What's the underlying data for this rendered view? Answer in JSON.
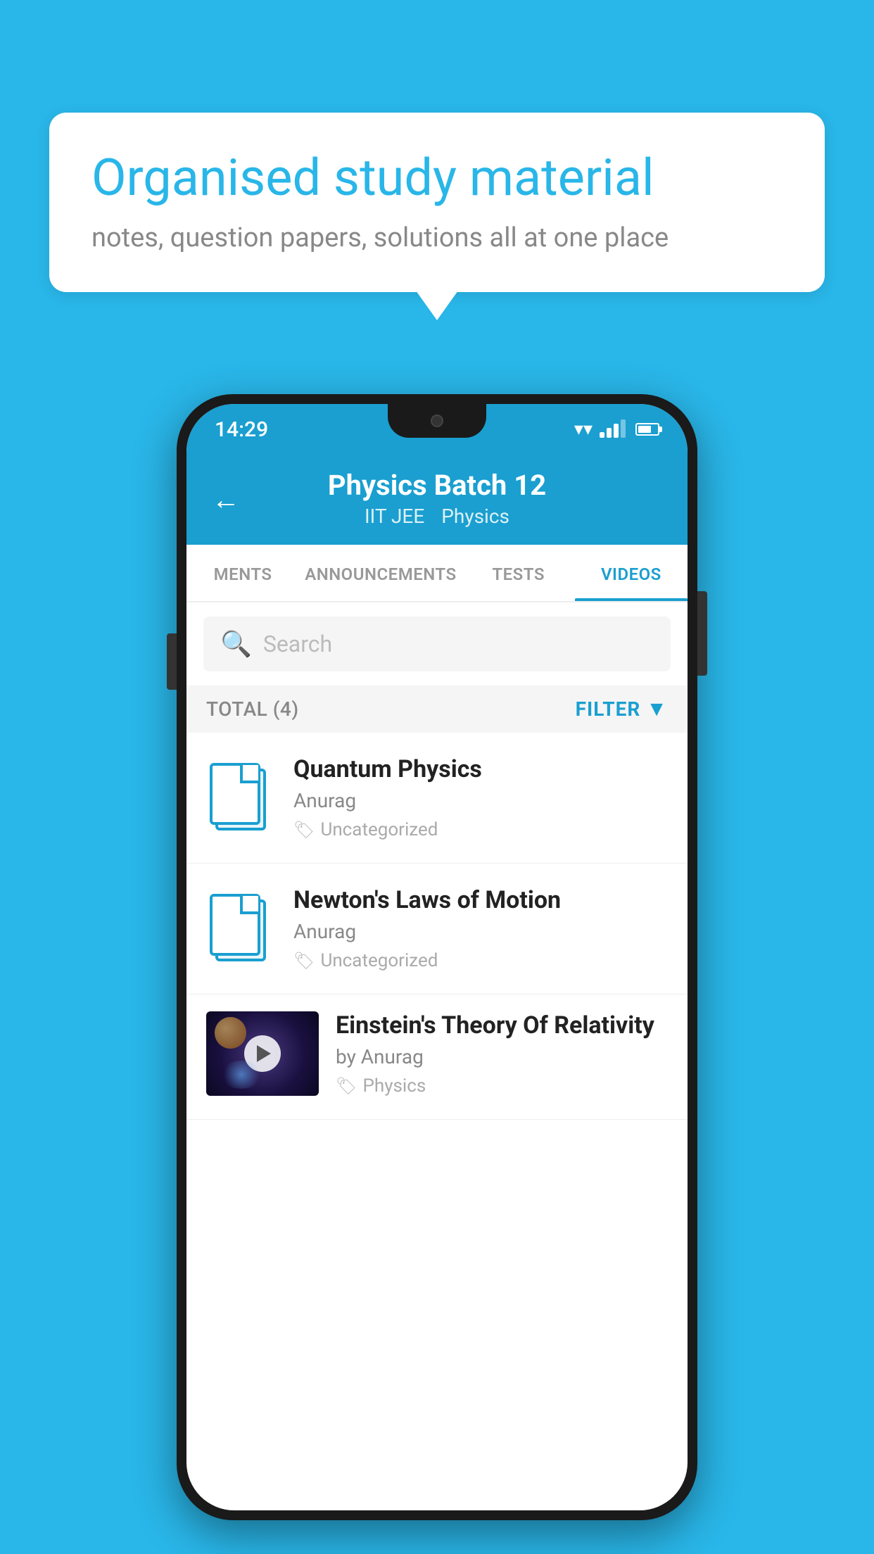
{
  "background_color": "#29b6e8",
  "speech_bubble": {
    "title": "Organised study material",
    "subtitle": "notes, question papers, solutions all at one place"
  },
  "status_bar": {
    "time": "14:29"
  },
  "app_header": {
    "title": "Physics Batch 12",
    "subtitle_items": [
      "IIT JEE",
      "Physics"
    ],
    "back_label": "←"
  },
  "tabs": [
    {
      "label": "MENTS",
      "active": false
    },
    {
      "label": "ANNOUNCEMENTS",
      "active": false
    },
    {
      "label": "TESTS",
      "active": false
    },
    {
      "label": "VIDEOS",
      "active": true
    }
  ],
  "search": {
    "placeholder": "Search"
  },
  "filter_row": {
    "total_label": "TOTAL (4)",
    "filter_label": "FILTER"
  },
  "videos": [
    {
      "title": "Quantum Physics",
      "author": "Anurag",
      "tag": "Uncategorized",
      "has_thumbnail": false
    },
    {
      "title": "Newton's Laws of Motion",
      "author": "Anurag",
      "tag": "Uncategorized",
      "has_thumbnail": false
    },
    {
      "title": "Einstein's Theory Of Relativity",
      "author": "by Anurag",
      "tag": "Physics",
      "has_thumbnail": true
    }
  ]
}
